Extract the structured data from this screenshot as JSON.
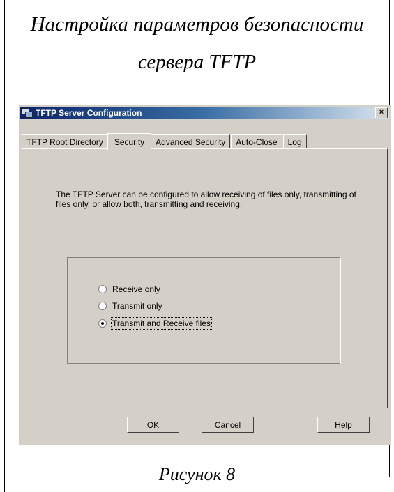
{
  "document": {
    "heading_line1": "Настройка параметров безопасности",
    "heading_line2": "сервера TFTP",
    "caption": "Рисунок 8"
  },
  "dialog": {
    "title": "TFTP Server Configuration",
    "close_label": "×",
    "tabs": [
      {
        "label": "TFTP Root Directory",
        "active": false
      },
      {
        "label": "Security",
        "active": true
      },
      {
        "label": "Advanced Security",
        "active": false
      },
      {
        "label": "Auto-Close",
        "active": false
      },
      {
        "label": "Log",
        "active": false
      }
    ],
    "description": "The TFTP Server can be configured to allow receiving of files only, transmitting of files only, or allow both, transmitting and receiving.",
    "options": [
      {
        "label": "Receive only",
        "selected": false
      },
      {
        "label": "Transmit only",
        "selected": false
      },
      {
        "label": "Transmit and Receive files",
        "selected": true
      }
    ],
    "buttons": {
      "ok": "OK",
      "cancel": "Cancel",
      "help": "Help"
    }
  }
}
